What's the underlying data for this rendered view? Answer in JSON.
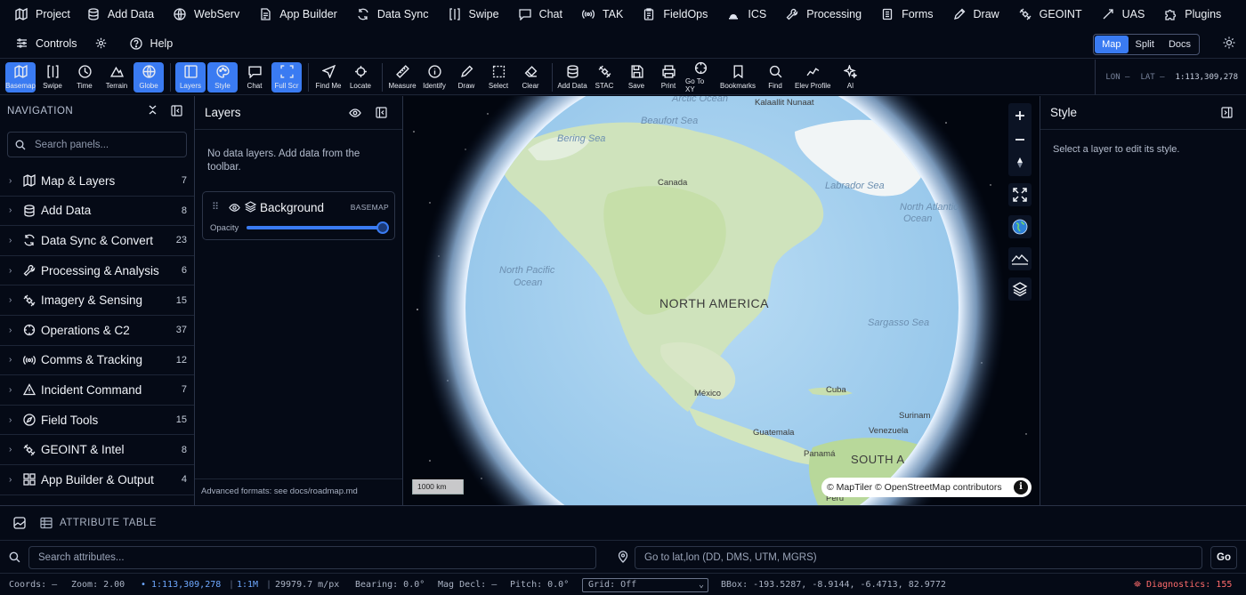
{
  "topbar": {
    "items": [
      {
        "label": "Project",
        "icon": "map-book-icon"
      },
      {
        "label": "Add Data",
        "icon": "database-icon"
      },
      {
        "label": "WebServ",
        "icon": "globe-icon"
      },
      {
        "label": "App Builder",
        "icon": "document-icon"
      },
      {
        "label": "Data Sync",
        "icon": "sync-icon"
      },
      {
        "label": "Swipe",
        "icon": "swipe-icon"
      },
      {
        "label": "Chat",
        "icon": "chat-icon"
      },
      {
        "label": "TAK",
        "icon": "broadcast-icon"
      },
      {
        "label": "FieldOps",
        "icon": "clipboard-icon"
      },
      {
        "label": "ICS",
        "icon": "ics-icon"
      },
      {
        "label": "Processing",
        "icon": "wrench-icon"
      },
      {
        "label": "Forms",
        "icon": "form-icon"
      },
      {
        "label": "Draw",
        "icon": "draw-icon"
      },
      {
        "label": "GEOINT",
        "icon": "satellite-icon"
      },
      {
        "label": "UAS",
        "icon": "drone-icon"
      },
      {
        "label": "Plugins",
        "icon": "puzzle-icon"
      }
    ]
  },
  "secondbar": {
    "controls_label": "Controls",
    "help_label": "Help",
    "views": [
      "Map",
      "Split",
      "Docs"
    ],
    "active_view": "Map"
  },
  "toolbar": {
    "tools": [
      {
        "label": "Basemap",
        "active": true
      },
      {
        "label": "Swipe",
        "active": false
      },
      {
        "label": "Time",
        "active": false
      },
      {
        "label": "Terrain",
        "active": false
      },
      {
        "label": "Globe",
        "active": true
      },
      {
        "label": "Layers",
        "active": true
      },
      {
        "label": "Style",
        "active": true
      },
      {
        "label": "Chat",
        "active": false
      },
      {
        "label": "Full Scr",
        "active": true
      },
      {
        "label": "Find Me",
        "active": false
      },
      {
        "label": "Locate",
        "active": false
      },
      {
        "label": "Measure",
        "active": false
      },
      {
        "label": "Identify",
        "active": false
      },
      {
        "label": "Draw",
        "active": false
      },
      {
        "label": "Select",
        "active": false
      },
      {
        "label": "Clear",
        "active": false
      },
      {
        "label": "Add Data",
        "active": false
      },
      {
        "label": "STAC",
        "active": false
      },
      {
        "label": "Save",
        "active": false
      },
      {
        "label": "Print",
        "active": false
      },
      {
        "label": "Go To XY",
        "active": false
      },
      {
        "label": "Bookmarks",
        "active": false
      },
      {
        "label": "Find",
        "active": false
      },
      {
        "label": "Elev Profile",
        "active": false
      },
      {
        "label": "AI",
        "active": false
      }
    ],
    "lon_label": "LON –",
    "lat_label": "LAT –",
    "scale": "1:113,309,278"
  },
  "navigation": {
    "title": "NAVIGATION",
    "search_placeholder": "Search panels...",
    "items": [
      {
        "label": "Map & Layers",
        "count": "7"
      },
      {
        "label": "Add Data",
        "count": "8"
      },
      {
        "label": "Data Sync & Convert",
        "count": "23"
      },
      {
        "label": "Processing & Analysis",
        "count": "6"
      },
      {
        "label": "Imagery & Sensing",
        "count": "15"
      },
      {
        "label": "Operations & C2",
        "count": "37"
      },
      {
        "label": "Comms & Tracking",
        "count": "12"
      },
      {
        "label": "Incident Command",
        "count": "7"
      },
      {
        "label": "Field Tools",
        "count": "15"
      },
      {
        "label": "GEOINT & Intel",
        "count": "8"
      },
      {
        "label": "App Builder & Output",
        "count": "4"
      }
    ]
  },
  "layers_panel": {
    "title": "Layers",
    "empty_text": "No data layers. Add data from the toolbar.",
    "layer_name": "Background",
    "layer_tag": "BASEMAP",
    "opacity_label": "Opacity",
    "opacity_value": 1.0,
    "footer": "Advanced formats: see docs/roadmap.md"
  },
  "map": {
    "labels": {
      "arctic": "Arctic Ocean",
      "beaufort": "Beaufort Sea",
      "kalaallit": "Kalaallit Nunaat",
      "bering": "Bering Sea",
      "canada": "Canada",
      "labrador": "Labrador Sea",
      "north_atlantic_1": "North Atlantic",
      "north_atlantic_2": "Ocean",
      "north_pacific_1": "North Pacific",
      "north_pacific_2": "Ocean",
      "north_america": "NORTH AMERICA",
      "sargasso": "Sargasso Sea",
      "mexico": "México",
      "cuba": "Cuba",
      "guatemala": "Guatemala",
      "venezuela": "Venezuela",
      "panama": "Panamá",
      "suriname": "Surinam",
      "south_america": "SOUTH A",
      "peru": "Perú"
    },
    "scale_label": "1000 km",
    "attribution": "© MapTiler © OpenStreetMap contributors"
  },
  "style_panel": {
    "title": "Style",
    "empty_text": "Select a layer to edit its style."
  },
  "attribute_table": {
    "title": "ATTRIBUTE TABLE",
    "search_placeholder": "Search attributes...",
    "goto_placeholder": "Go to lat,lon (DD, DMS, UTM, MGRS)",
    "go_label": "Go"
  },
  "status": {
    "coords": "Coords: –",
    "zoom": "Zoom: 2.00",
    "scale": "1:113,309,278",
    "ratio": "1:1M",
    "resolution": "29979.7 m/px",
    "bearing": "Bearing: 0.0°",
    "mag_decl": "Mag Decl: –",
    "pitch": "Pitch: 0.0°",
    "grid": "Grid: Off",
    "bbox": "BBox: -193.5287, -8.9144, -6.4713, 82.9772",
    "diagnostics": "Diagnostics: 155"
  }
}
